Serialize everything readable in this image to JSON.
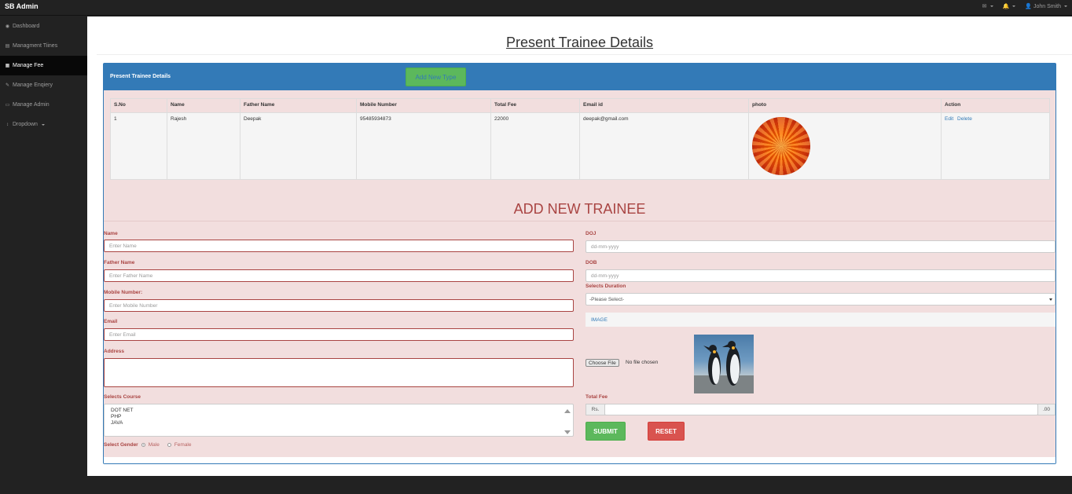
{
  "app": {
    "brand": "SB Admin"
  },
  "topnav": {
    "user_name": "John Smith",
    "icons": [
      "envelope-icon",
      "bell-icon",
      "user-icon"
    ]
  },
  "sidebar": {
    "items": [
      {
        "label": "Dashboard",
        "icon": "dashboard-icon",
        "active": false
      },
      {
        "label": "Managment Tiines",
        "icon": "bar-chart-icon",
        "active": false
      },
      {
        "label": "Manage Fee",
        "icon": "table-icon",
        "active": true
      },
      {
        "label": "Manage Enqiery",
        "icon": "edit-icon",
        "active": false
      },
      {
        "label": "Manage Admin",
        "icon": "desktop-icon",
        "active": false
      },
      {
        "label": "Dropdown",
        "icon": "arrows-v-icon",
        "active": false
      }
    ]
  },
  "page": {
    "title": "Present Trainee Details"
  },
  "panel": {
    "heading": "Present Trainee Details",
    "add_button": "Add New Type"
  },
  "table": {
    "headers": [
      "S.No",
      "Name",
      "Father Name",
      "Mobile Number",
      "Total Fee",
      "Email id",
      "photo",
      "Action"
    ],
    "rows": [
      {
        "sno": "1",
        "name": "Rajesh",
        "father": "Deepak",
        "mobile": "95485934873",
        "fee": "22000",
        "email": "deepak@gmail.com",
        "edit": "Edit",
        "delete": "Delete"
      }
    ]
  },
  "form": {
    "title": "ADD NEW TRAINEE",
    "name": {
      "label": "Name",
      "placeholder": "Enter Name"
    },
    "father_name": {
      "label": "Father Name",
      "placeholder": "Enter Father Name"
    },
    "mobile": {
      "label": "Mobile Number:",
      "placeholder": "Enter Mobile Number"
    },
    "email": {
      "label": "Email",
      "placeholder": "Enter Email"
    },
    "address": {
      "label": "Address"
    },
    "course": {
      "label": "Selects Course",
      "options": [
        "DOT NET",
        "PHP",
        "JAVA"
      ]
    },
    "gender": {
      "label": "Select Gender",
      "options": [
        "Male",
        "Female"
      ],
      "selected": "Male"
    },
    "doj": {
      "label": "DOJ",
      "placeholder": "dd-mm-yyyy"
    },
    "dob": {
      "label": "DOB",
      "placeholder": "dd-mm-yyyy"
    },
    "duration": {
      "label": "Selects Duration",
      "selected": "-Please Select-"
    },
    "image": {
      "label": "IMAGE",
      "button": "Choose File",
      "status": "No file chosen"
    },
    "total_fee": {
      "label": "Total Fee",
      "prefix": "Rs.",
      "suffix": ".00"
    },
    "submit": "SUBMIT",
    "reset": "RESET"
  }
}
